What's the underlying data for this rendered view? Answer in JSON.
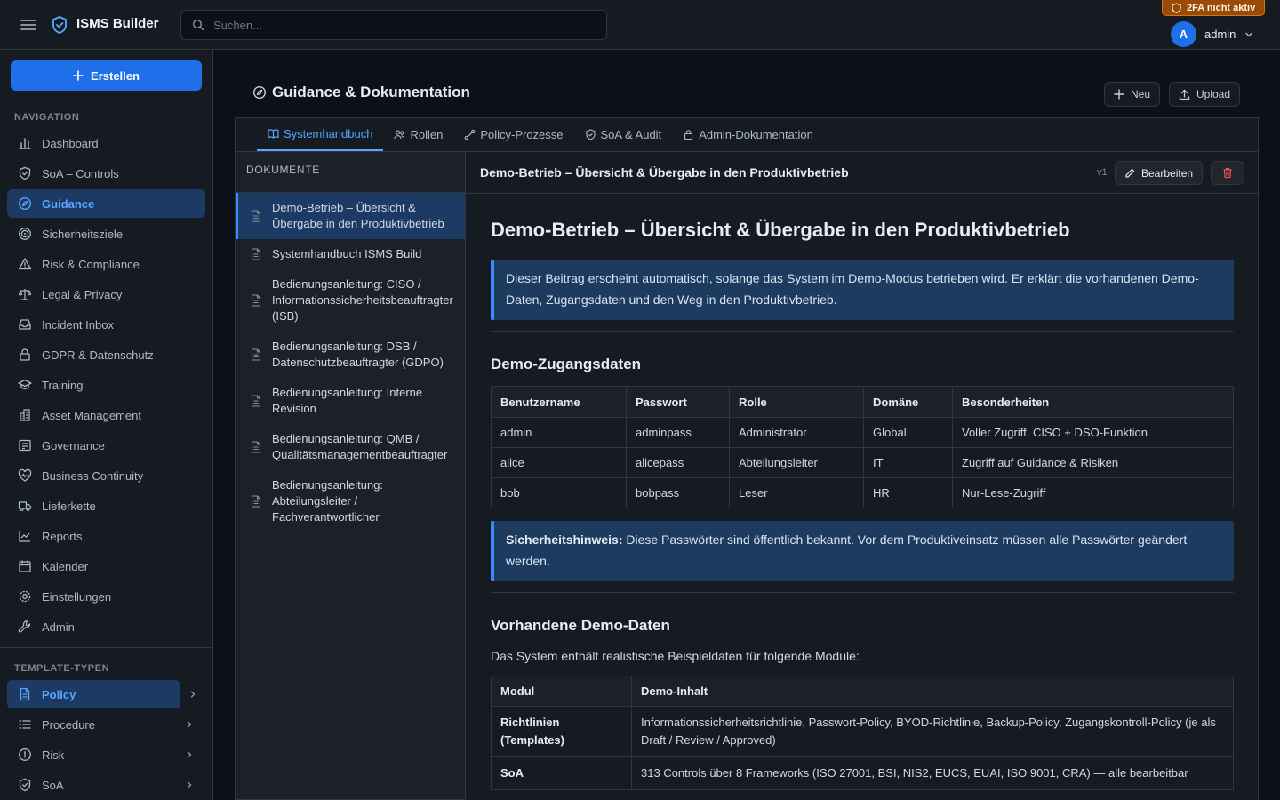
{
  "app": {
    "title": "ISMS Builder"
  },
  "search": {
    "placeholder": "Suchen..."
  },
  "security_badge": "2FA nicht aktiv",
  "user": {
    "initial": "A",
    "name": "admin"
  },
  "sidebar": {
    "create_label": "Erstellen",
    "nav_label": "NAVIGATION",
    "nav_items": [
      {
        "label": "Dashboard",
        "icon": "bar-chart-icon"
      },
      {
        "label": "SoA – Controls",
        "icon": "shield-check-icon"
      },
      {
        "label": "Guidance",
        "icon": "compass-icon"
      },
      {
        "label": "Sicherheitsziele",
        "icon": "target-icon"
      },
      {
        "label": "Risk & Compliance",
        "icon": "warning-triangle-icon"
      },
      {
        "label": "Legal & Privacy",
        "icon": "scale-icon"
      },
      {
        "label": "Incident Inbox",
        "icon": "inbox-icon"
      },
      {
        "label": "GDPR & Datenschutz",
        "icon": "lock-icon"
      },
      {
        "label": "Training",
        "icon": "graduation-cap-icon"
      },
      {
        "label": "Asset Management",
        "icon": "building-icon"
      },
      {
        "label": "Governance",
        "icon": "governance-icon"
      },
      {
        "label": "Business Continuity",
        "icon": "heart-pulse-icon"
      },
      {
        "label": "Lieferkette",
        "icon": "truck-icon"
      },
      {
        "label": "Reports",
        "icon": "line-chart-icon"
      },
      {
        "label": "Kalender",
        "icon": "calendar-icon"
      },
      {
        "label": "Einstellungen",
        "icon": "gear-icon"
      },
      {
        "label": "Admin",
        "icon": "wrench-icon"
      }
    ],
    "template_label": "TEMPLATE-TYPEN",
    "template_items": [
      {
        "label": "Policy",
        "icon": "document-icon"
      },
      {
        "label": "Procedure",
        "icon": "list-icon"
      },
      {
        "label": "Risk",
        "icon": "alert-circle-icon"
      },
      {
        "label": "SoA",
        "icon": "shield-check-icon"
      }
    ]
  },
  "page": {
    "title": "Guidance & Dokumentation",
    "new_label": "Neu",
    "upload_label": "Upload",
    "tabs": [
      {
        "label": "Systemhandbuch",
        "icon": "book-icon"
      },
      {
        "label": "Rollen",
        "icon": "users-icon"
      },
      {
        "label": "Policy-Prozesse",
        "icon": "flow-icon"
      },
      {
        "label": "SoA & Audit",
        "icon": "shield-check-icon"
      },
      {
        "label": "Admin-Dokumentation",
        "icon": "lock-icon"
      }
    ]
  },
  "documents": {
    "header": "DOKUMENTE",
    "items": [
      "Demo-Betrieb – Übersicht & Übergabe in den Produktivbetrieb",
      "Systemhandbuch ISMS Build",
      "Bedienungsanleitung: CISO / Informationssicherheitsbeauftragter (ISB)",
      "Bedienungsanleitung: DSB / Datenschutzbeauftragter (GDPO)",
      "Bedienungsanleitung: Interne Revision",
      "Bedienungsanleitung: QMB / Qualitätsmanagementbeauftragter",
      "Bedienungsanleitung: Abteilungsleiter / Fachverantwortlicher"
    ]
  },
  "doc": {
    "title": "Demo-Betrieb – Übersicht & Übergabe in den Produktivbetrieb",
    "version": "v1",
    "edit_label": "Bearbeiten",
    "heading": "Demo-Betrieb – Übersicht & Übergabe in den Produktivbetrieb",
    "intro": "Dieser Beitrag erscheint automatisch, solange das System im Demo-Modus betrieben wird. Er erklärt die vorhandenen Demo-Daten, Zugangsdaten und den Weg in den Produktivbetrieb.",
    "section1": "Demo-Zugangsdaten",
    "table1": {
      "headers": [
        "Benutzername",
        "Passwort",
        "Rolle",
        "Domäne",
        "Besonderheiten"
      ],
      "rows": [
        [
          "admin",
          "adminpass",
          "Administrator",
          "Global",
          "Voller Zugriff, CISO + DSO-Funktion"
        ],
        [
          "alice",
          "alicepass",
          "Abteilungsleiter",
          "IT",
          "Zugriff auf Guidance & Risiken"
        ],
        [
          "bob",
          "bobpass",
          "Leser",
          "HR",
          "Nur-Lese-Zugriff"
        ]
      ]
    },
    "warning_strong": "Sicherheitshinweis:",
    "warning_text": " Diese Passwörter sind öffentlich bekannt. Vor dem Produktiveinsatz müssen alle Passwörter geändert werden.",
    "section2": "Vorhandene Demo-Daten",
    "section2_intro": "Das System enthält realistische Beispieldaten für folgende Module:",
    "table2": {
      "headers": [
        "Modul",
        "Demo-Inhalt"
      ],
      "rows": [
        [
          "Richtlinien (Templates)",
          "Informationssicherheitsrichtlinie, Passwort-Policy, BYOD-Richtlinie, Backup-Policy, Zugangskontroll-Policy (je als Draft / Review / Approved)"
        ],
        [
          "SoA",
          "313 Controls über 8 Frameworks (ISO 27001, BSI, NIS2, EUCS, EUAI, ISO 9001, CRA) — alle bearbeitbar"
        ]
      ]
    }
  },
  "colors": {
    "accent": "#1f6feb",
    "active_bg": "#1c3a63",
    "callout_bg": "#1d3a5f",
    "badge": "#9a4a07",
    "danger": "#f85149"
  }
}
